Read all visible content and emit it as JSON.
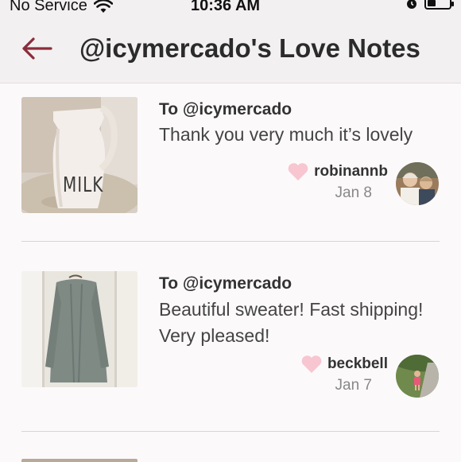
{
  "status_bar": {
    "carrier": "No Service",
    "time": "10:36 AM",
    "icons": [
      "wifi-icon",
      "alarm-icon",
      "battery-icon"
    ]
  },
  "header": {
    "back_icon": "back-arrow-icon",
    "title": "@icymercado's Love Notes"
  },
  "notes": [
    {
      "to": "To @icymercado",
      "message": "Thank you very much it’s lovely",
      "author": "robinannb",
      "date": "Jan 8",
      "thumbnail_text": "MILK"
    },
    {
      "to": "To @icymercado",
      "message": "Beautiful sweater! Fast shipping! Very pleased!",
      "author": "beckbell",
      "date": "Jan 7"
    }
  ],
  "colors": {
    "accent": "#8b2c3a",
    "heart": "#f7c6d0",
    "header_bg": "#f3f0f2",
    "page_bg": "#fcf9fb"
  }
}
